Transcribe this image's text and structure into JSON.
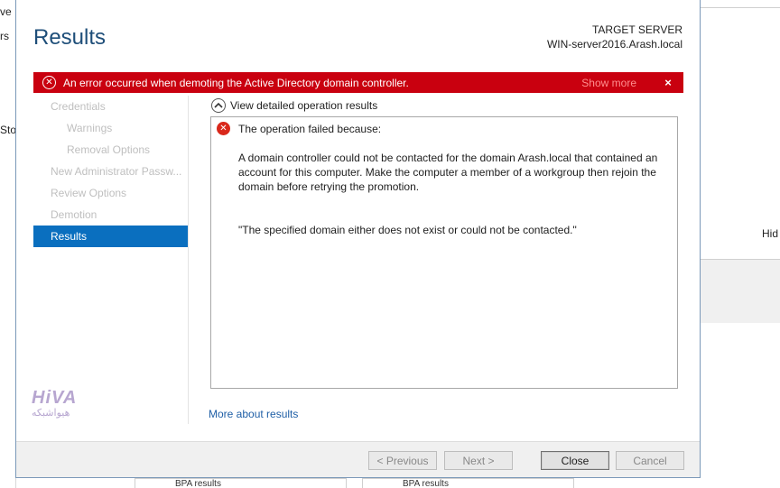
{
  "background": {
    "frag_top": "ve",
    "frag_rs": "rs",
    "frag_sto": "Sto",
    "frag_hid": "Hid",
    "bottom_left": "BPA results",
    "bottom_right": "BPA results"
  },
  "wizard": {
    "title": "Results",
    "target_label": "TARGET SERVER",
    "target_server": "WIN-server2016.Arash.local"
  },
  "error_bar": {
    "message": "An error occurred when demoting the Active Directory domain controller.",
    "show_more": "Show more",
    "close": "×",
    "color": "#c9000f"
  },
  "nav": {
    "items": [
      {
        "label": "Credentials"
      },
      {
        "label": "Warnings"
      },
      {
        "label": "Removal Options"
      },
      {
        "label": "New Administrator Passw..."
      },
      {
        "label": "Review Options"
      },
      {
        "label": "Demotion"
      },
      {
        "label": "Results"
      }
    ]
  },
  "details": {
    "expander_label": "View detailed operation results",
    "heading": "The operation failed because:",
    "paragraph": "A domain controller could not be contacted for the domain Arash.local that contained an account for this computer. Make the computer a member of a workgroup then rejoin the domain before retrying the promotion.",
    "quote": "\"The specified domain either does not exist or could not be contacted.\""
  },
  "more_link": "More about results",
  "logo": {
    "name": "HiVA",
    "subtitle": "هیواشبکه"
  },
  "buttons": {
    "previous": "< Previous",
    "next": "Next >",
    "close": "Close",
    "cancel": "Cancel"
  }
}
